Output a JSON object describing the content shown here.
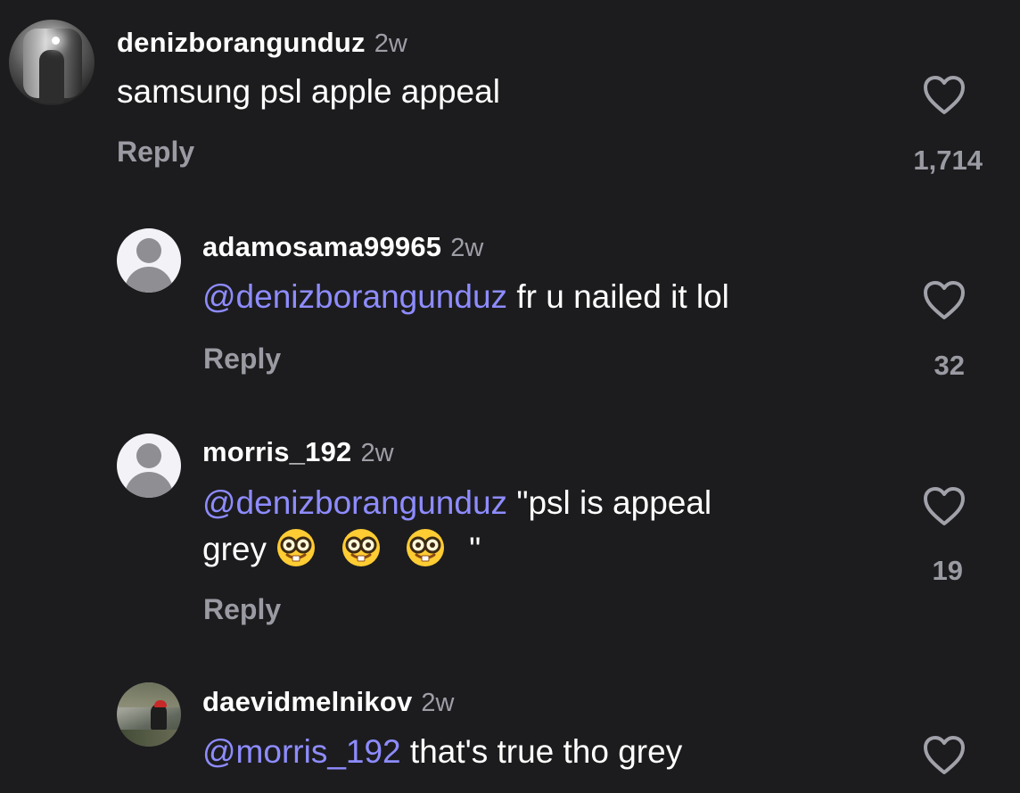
{
  "comments": [
    {
      "username": "denizborangunduz",
      "time": "2w",
      "text": "samsung psl apple appeal",
      "reply_label": "Reply",
      "likes": "1,714",
      "avatar_icon": "profile-photo-avatar"
    },
    {
      "username": "adamosama99965",
      "time": "2w",
      "mention": "@denizborangunduz",
      "text": " fr u nailed it lol",
      "reply_label": "Reply",
      "likes": "32",
      "avatar_icon": "default-avatar-icon"
    },
    {
      "username": "morris_192",
      "time": "2w",
      "mention": "@denizborangunduz",
      "text_line1": " \"psl is appeal",
      "text_line2_prefix": "grey",
      "text_line2_suffix": " \"",
      "emoji_names": [
        "nerd-face-emoji",
        "nerd-face-emoji",
        "nerd-face-emoji"
      ],
      "reply_label": "Reply",
      "likes": "19",
      "avatar_icon": "default-avatar-icon"
    },
    {
      "username": "daevidmelnikov",
      "time": "2w",
      "mention": "@morris_192",
      "text": " that's true tho grey",
      "avatar_icon": "profile-photo-avatar"
    }
  ],
  "colors": {
    "background": "#1c1c1e",
    "mention": "#8e8cff",
    "secondary_text": "#9a9aa3",
    "primary_text": "#ffffff"
  },
  "icons": {
    "like": "heart-outline-icon",
    "emoji": "nerd-face-emoji"
  }
}
